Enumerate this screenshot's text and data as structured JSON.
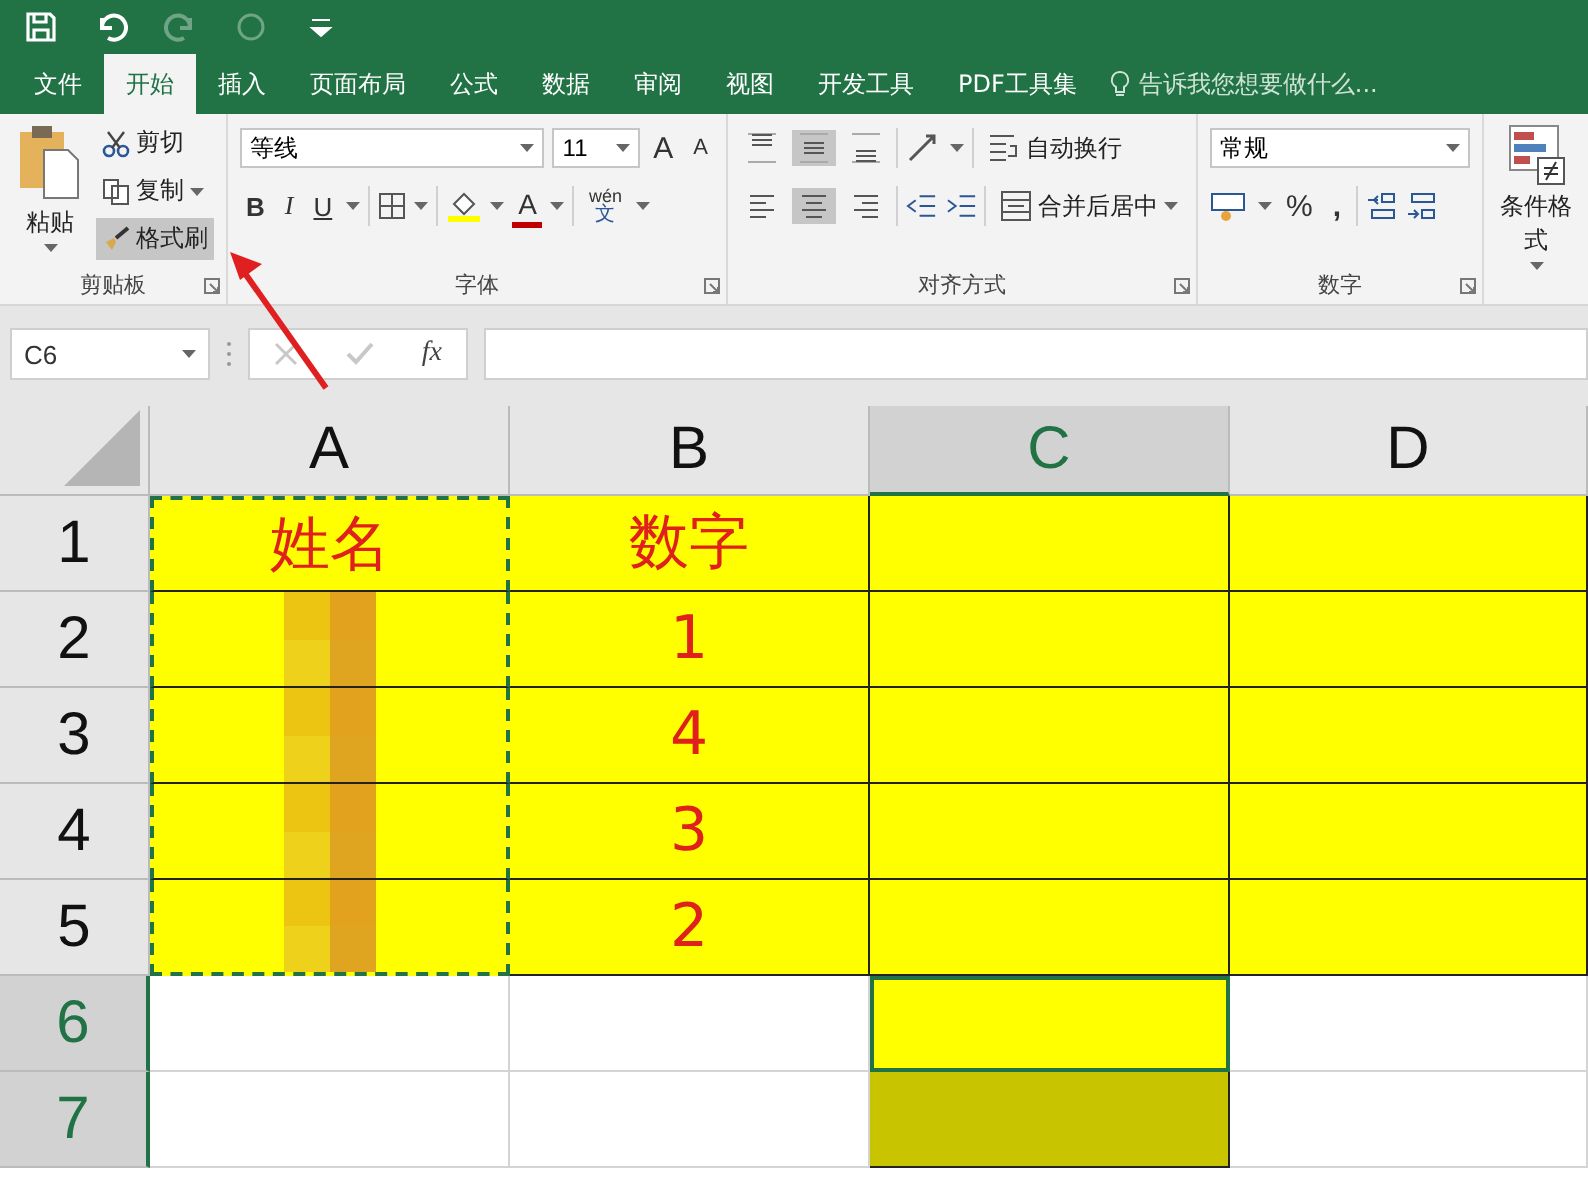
{
  "quick_access": [
    {
      "kind": "save",
      "disabled": false
    },
    {
      "kind": "undo",
      "disabled": false
    },
    {
      "kind": "redo",
      "disabled": true
    },
    {
      "kind": "touch",
      "disabled": true
    },
    {
      "kind": "customize",
      "disabled": false
    }
  ],
  "tabs": [
    {
      "label": "文件",
      "selected": false
    },
    {
      "label": "开始",
      "selected": true
    },
    {
      "label": "插入",
      "selected": false
    },
    {
      "label": "页面布局",
      "selected": false
    },
    {
      "label": "公式",
      "selected": false
    },
    {
      "label": "数据",
      "selected": false
    },
    {
      "label": "审阅",
      "selected": false
    },
    {
      "label": "视图",
      "selected": false
    },
    {
      "label": "开发工具",
      "selected": false
    },
    {
      "label": "PDF工具集",
      "selected": false
    }
  ],
  "tell_me": {
    "placeholder": "告诉我您想要做什么..."
  },
  "clipboard": {
    "label": "剪贴板",
    "paste": "粘贴",
    "cut": "剪切",
    "copy": "复制",
    "format_painter": {
      "label": "格式刷",
      "selected": true
    }
  },
  "font": {
    "label": "字体",
    "name": "等线",
    "size": "11",
    "grow": "A",
    "shrink": "A",
    "bold": "B",
    "italic": "I",
    "underline": "U",
    "color_letter": "A",
    "phonetic_top": "wén",
    "phonetic_bottom": "文"
  },
  "alignment": {
    "label": "对齐方式",
    "wrap": "自动换行",
    "merge": "合并后居中",
    "vertical": [
      {
        "selected": false
      },
      {
        "selected": true
      },
      {
        "selected": false
      }
    ],
    "horizontal": [
      {
        "selected": false
      },
      {
        "selected": true
      },
      {
        "selected": false
      }
    ]
  },
  "number": {
    "label": "数字",
    "format": "常规",
    "percent": "%",
    "comma": ","
  },
  "styles": {
    "conditional": "条件格式"
  },
  "formula_bar": {
    "name_box": "C6",
    "fx": "fx"
  },
  "sheet": {
    "columns": [
      {
        "label": "A",
        "selected": false
      },
      {
        "label": "B",
        "selected": false
      },
      {
        "label": "C",
        "selected": true
      },
      {
        "label": "D",
        "selected": false
      }
    ],
    "rows": [
      {
        "header": "1",
        "selected": false,
        "cells": [
          {
            "text": "姓名",
            "color": "#ffff00",
            "marquee": true
          },
          {
            "text": "数字",
            "color": "#ffff00"
          },
          {
            "color": "#ffff00"
          },
          {
            "color": "#ffff00"
          }
        ]
      },
      {
        "header": "2",
        "selected": false,
        "cells": [
          {
            "color": "#ffff00",
            "marquee": true,
            "redacted": true
          },
          {
            "text": "1",
            "color": "#ffff00"
          },
          {
            "color": "#ffff00"
          },
          {
            "color": "#ffff00"
          }
        ]
      },
      {
        "header": "3",
        "selected": false,
        "cells": [
          {
            "color": "#ffff00",
            "marquee": true,
            "redacted": true
          },
          {
            "text": "4",
            "color": "#ffff00"
          },
          {
            "color": "#ffff00"
          },
          {
            "color": "#ffff00"
          }
        ]
      },
      {
        "header": "4",
        "selected": false,
        "cells": [
          {
            "color": "#ffff00",
            "marquee": true,
            "redacted": true
          },
          {
            "text": "3",
            "color": "#ffff00"
          },
          {
            "color": "#ffff00"
          },
          {
            "color": "#ffff00"
          }
        ]
      },
      {
        "header": "5",
        "selected": false,
        "cells": [
          {
            "color": "#ffff00",
            "marquee": true,
            "redacted": true
          },
          {
            "text": "2",
            "color": "#ffff00"
          },
          {
            "color": "#ffff00"
          },
          {
            "color": "#ffff00"
          }
        ]
      },
      {
        "header": "6",
        "selected": true,
        "cells": [
          {},
          {},
          {
            "color": "#ffff00",
            "active": true
          },
          {}
        ]
      },
      {
        "header": "7",
        "selected": true,
        "cells": [
          {},
          {},
          {
            "color": "#c8c400"
          },
          {}
        ]
      }
    ]
  }
}
